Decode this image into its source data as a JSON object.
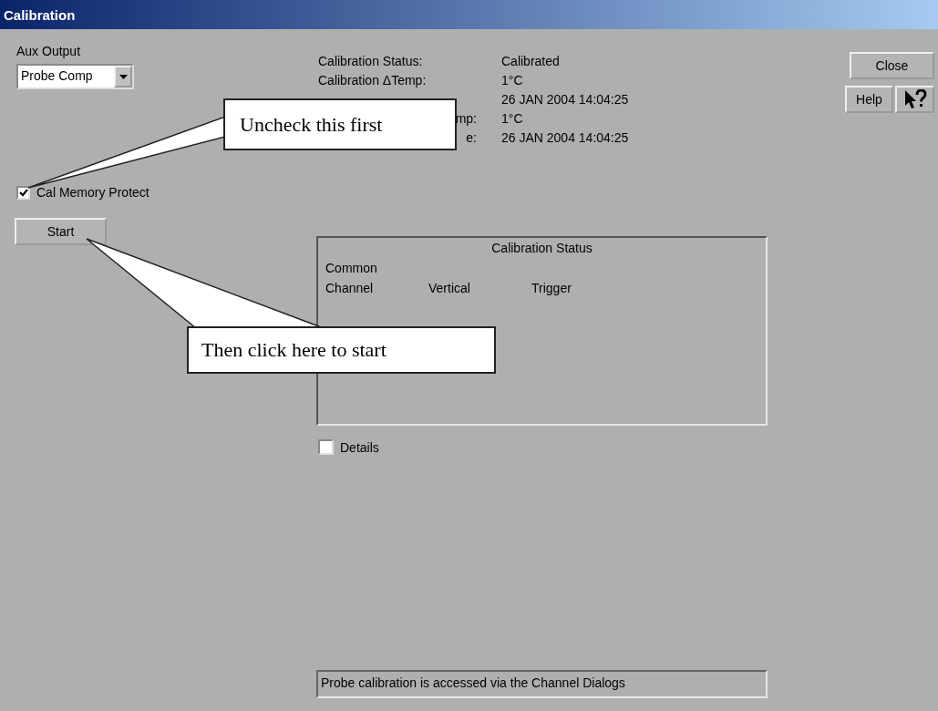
{
  "window": {
    "title": "Calibration"
  },
  "aux_output": {
    "label": "Aux Output",
    "value": "Probe Comp"
  },
  "cal_memory_protect": {
    "label": "Cal Memory Protect",
    "checked": true
  },
  "start_button": "Start",
  "info": [
    {
      "label": "Calibration Status:",
      "value": "Calibrated"
    },
    {
      "label": "Calibration ΔTemp:",
      "value": "1°C"
    },
    {
      "value": "26 JAN 2004 14:04:25"
    },
    {
      "label": "mp:",
      "value": "1°C"
    },
    {
      "label": "e:",
      "value": "26 JAN 2004 14:04:25"
    }
  ],
  "status_group": {
    "title": "Calibration Status",
    "common": "Common",
    "columns": [
      "Channel",
      "Vertical",
      "Trigger"
    ]
  },
  "details": {
    "label": "Details",
    "checked": false
  },
  "message": "Probe calibration is accessed via the Channel Dialogs",
  "buttons": {
    "close": "Close",
    "help": "Help"
  },
  "callouts": [
    {
      "text": "Uncheck this first"
    },
    {
      "text": "Then click here to start"
    }
  ]
}
